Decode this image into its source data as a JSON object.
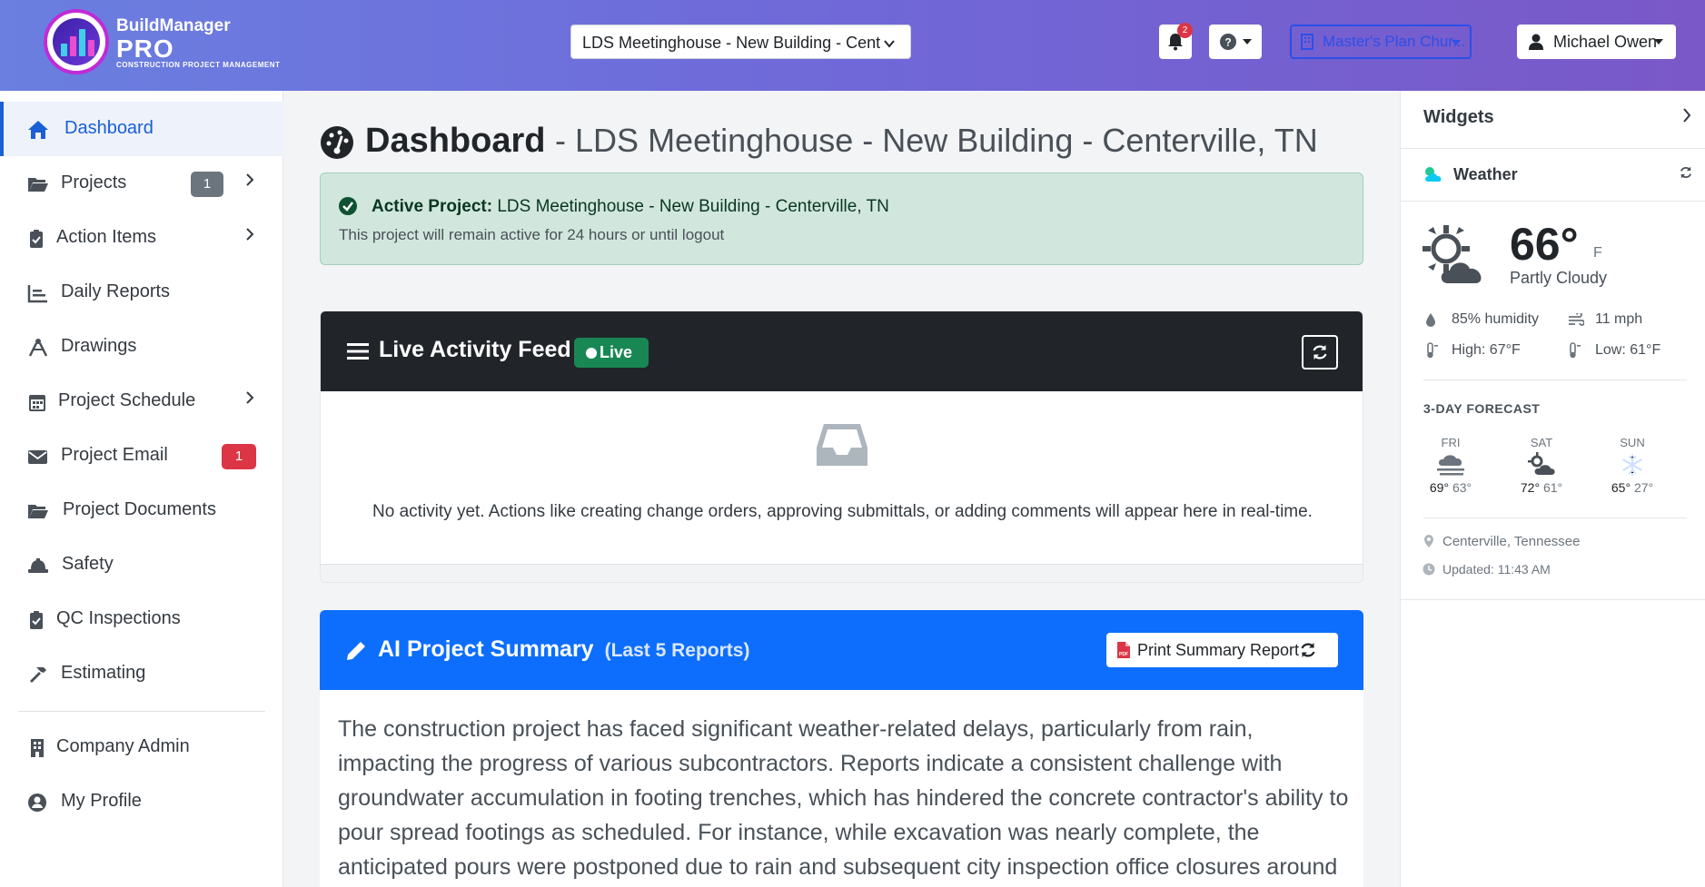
{
  "brand": {
    "name": "BuildManager",
    "pro": "PRO",
    "tagline": "CONSTRUCTION PROJECT MANAGEMENT"
  },
  "header": {
    "project_select": "LDS Meetinghouse - New Building - Cent",
    "notifications_count": "2",
    "plan_button": "Master's Plan Chur...",
    "user_name": "Michael Owen"
  },
  "sidebar": {
    "items": [
      {
        "label": "Dashboard"
      },
      {
        "label": "Projects",
        "badge": "1"
      },
      {
        "label": "Action Items"
      },
      {
        "label": "Daily Reports"
      },
      {
        "label": "Drawings"
      },
      {
        "label": "Project Schedule"
      },
      {
        "label": "Project Email",
        "badge": "1"
      },
      {
        "label": "Project Documents"
      },
      {
        "label": "Safety"
      },
      {
        "label": "QC Inspections"
      },
      {
        "label": "Estimating"
      },
      {
        "label": "Company Admin"
      },
      {
        "label": "My Profile"
      }
    ]
  },
  "page": {
    "title": "Dashboard",
    "subtitle": "- LDS Meetinghouse - New Building - Centerville, TN"
  },
  "alert": {
    "label": "Active Project:",
    "project": "LDS Meetinghouse - New Building - Centerville, TN",
    "note": "This project will remain active for 24 hours or until logout"
  },
  "feed": {
    "title": "Live Activity Feed",
    "live_badge": "Live",
    "empty_message": "No activity yet. Actions like creating change orders, approving submittals, or adding comments will appear here in real-time."
  },
  "ai_summary": {
    "title": "AI Project Summary",
    "subtitle": "(Last 5 Reports)",
    "print_button": "Print Summary Report",
    "body": "The construction project has faced significant weather-related delays, particularly from rain, impacting the progress of various subcontractors. Reports indicate a consistent challenge with groundwater accumulation in footing trenches, which has hindered the concrete contractor's ability to pour spread footings as scheduled. For instance, while excavation was nearly complete, the anticipated pours were postponed due to rain and subsequent city inspection office closures around the holiday period..."
  },
  "widgets": {
    "title": "Widgets",
    "weather": {
      "title": "Weather",
      "temperature": "66°",
      "unit": "F",
      "condition": "Partly Cloudy",
      "humidity": "85% humidity",
      "wind": "11 mph",
      "high": "High: 67°F",
      "low": "Low: 61°F",
      "forecast_title": "3-DAY FORECAST",
      "forecast": [
        {
          "day": "FRI",
          "high": "69°",
          "low": "63°"
        },
        {
          "day": "SAT",
          "high": "72°",
          "low": "61°"
        },
        {
          "day": "SUN",
          "high": "65°",
          "low": "27°"
        }
      ],
      "location": "Centerville, Tennessee",
      "updated": "Updated: 11:43 AM"
    }
  },
  "colors": {
    "primary": "#0d6efd",
    "success": "#198754",
    "danger": "#dc3545",
    "dark": "#212529",
    "sidebar_active": "#1a5fd6"
  }
}
